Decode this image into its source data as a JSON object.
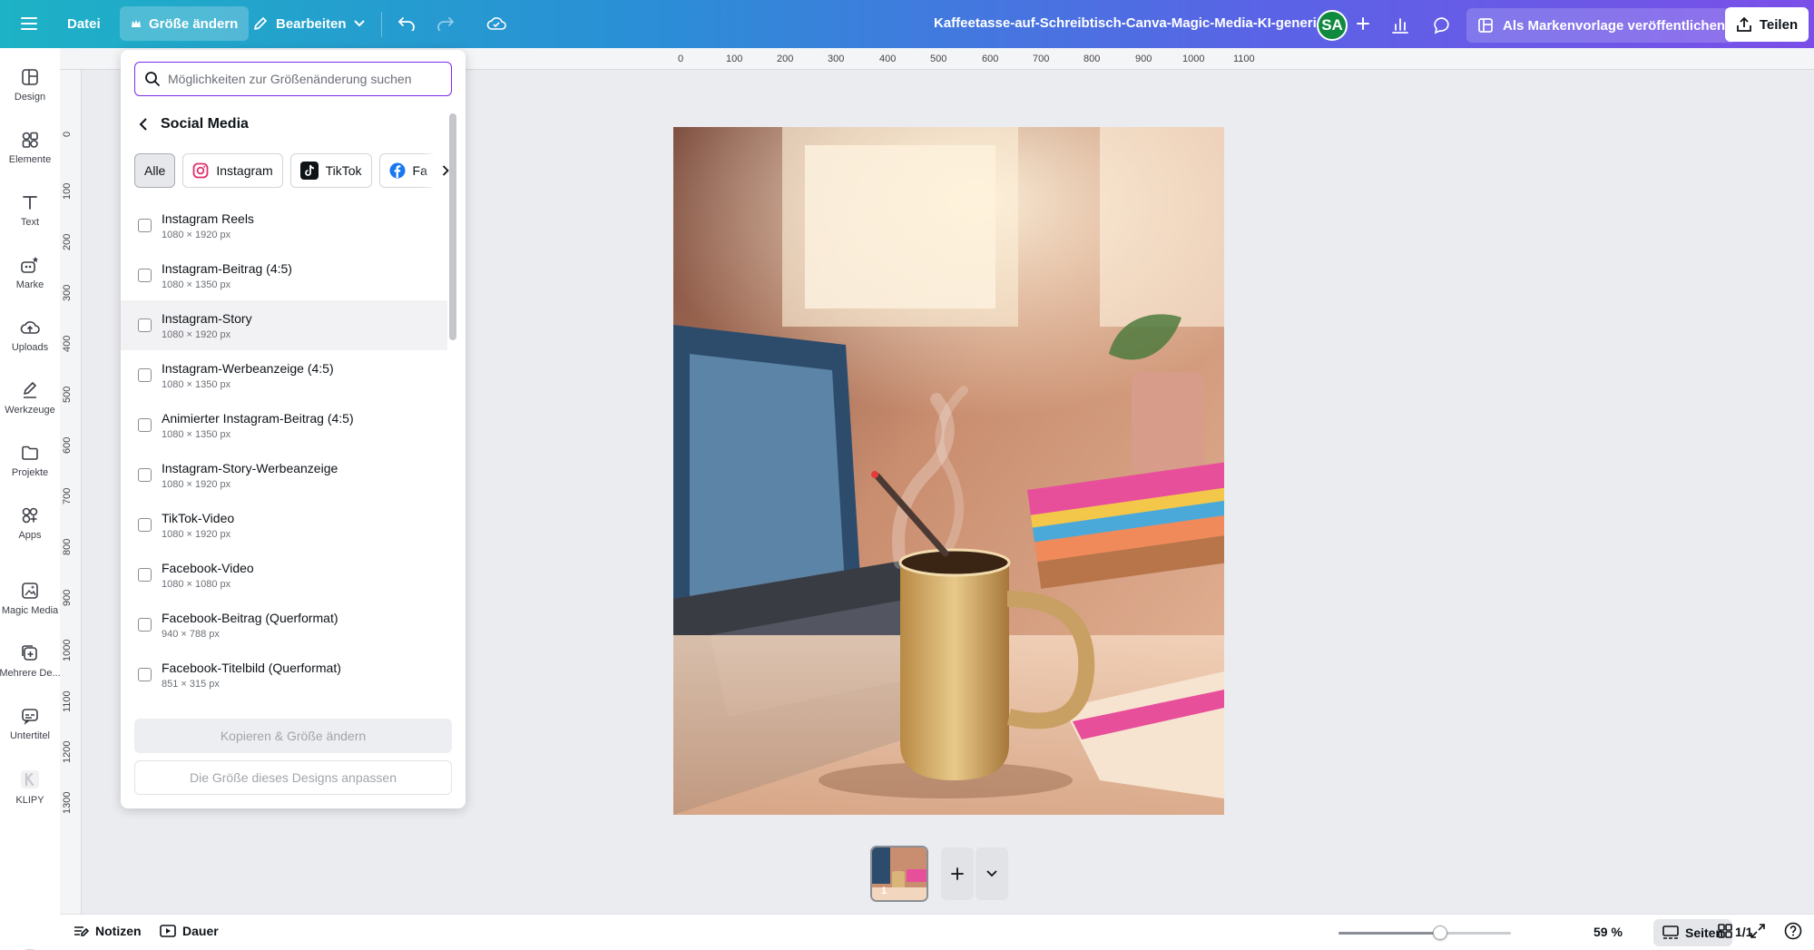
{
  "topbar": {
    "menu_icon": "hamburger-icon",
    "file_label": "Datei",
    "resize_label": "Größe ändern",
    "edit_label": "Bearbeiten",
    "doc_title": "Kaffeetasse-auf-Schreibtisch-Canva-Magic-Media-KI-generi...",
    "avatar_initials": "SA",
    "brand_template_label": "Als Markenvorlage veröffentlichen",
    "share_label": "Teilen"
  },
  "rail": {
    "items": [
      {
        "label": "Design",
        "icon": "layout-icon"
      },
      {
        "label": "Elemente",
        "icon": "shapes-icon"
      },
      {
        "label": "Text",
        "icon": "text-icon"
      },
      {
        "label": "Marke",
        "icon": "brand-icon"
      },
      {
        "label": "Uploads",
        "icon": "cloud-upload-icon"
      },
      {
        "label": "Werkzeuge",
        "icon": "pen-icon"
      },
      {
        "label": "Projekte",
        "icon": "folder-icon"
      },
      {
        "label": "Apps",
        "icon": "apps-icon"
      },
      {
        "label": "Magic Media",
        "icon": "magic-media-icon"
      },
      {
        "label": "Mehrere De...",
        "icon": "multiple-designs-icon"
      },
      {
        "label": "Untertitel",
        "icon": "subtitles-icon"
      },
      {
        "label": "KLIPY",
        "icon": "klipy-icon"
      }
    ]
  },
  "ruler": {
    "top_ticks": [
      "0",
      "100",
      "200",
      "300",
      "400",
      "500",
      "600",
      "700",
      "800",
      "900",
      "1000",
      "1100"
    ],
    "left_ticks": [
      "0",
      "100",
      "200",
      "300",
      "400",
      "500",
      "600",
      "700",
      "800",
      "900",
      "1000",
      "1100",
      "1200",
      "1300"
    ]
  },
  "resize_panel": {
    "search_placeholder": "Möglichkeiten zur Größenänderung suchen",
    "section_title": "Social Media",
    "chips": [
      {
        "label": "Alle",
        "selected": true
      },
      {
        "label": "Instagram",
        "icon": "instagram-icon"
      },
      {
        "label": "TikTok",
        "icon": "tiktok-icon"
      },
      {
        "label": "Fa",
        "icon": "facebook-icon"
      }
    ],
    "items": [
      {
        "name": "Instagram Reels",
        "size": "1080 × 1920 px",
        "checked": false
      },
      {
        "name": "Instagram-Beitrag (4:5)",
        "size": "1080 × 1350 px",
        "checked": false
      },
      {
        "name": "Instagram-Story",
        "size": "1080 × 1920 px",
        "checked": false,
        "hovered": true
      },
      {
        "name": "Instagram-Werbeanzeige (4:5)",
        "size": "1080 × 1350 px",
        "checked": false
      },
      {
        "name": "Animierter Instagram-Beitrag (4:5)",
        "size": "1080 × 1350 px",
        "checked": false
      },
      {
        "name": "Instagram-Story-Werbeanzeige",
        "size": "1080 × 1920 px",
        "checked": false
      },
      {
        "name": "TikTok-Video",
        "size": "1080 × 1920 px",
        "checked": false
      },
      {
        "name": "Facebook-Video",
        "size": "1080 × 1080 px",
        "checked": false
      },
      {
        "name": "Facebook-Beitrag (Querformat)",
        "size": "940 × 788 px",
        "checked": false
      },
      {
        "name": "Facebook-Titelbild (Querformat)",
        "size": "851 × 315 px",
        "checked": false
      }
    ],
    "copy_resize_label": "Kopieren & Größe ändern",
    "adapt_label": "Die Größe dieses Designs anpassen"
  },
  "pages": {
    "thumb_number": "1"
  },
  "bottombar": {
    "notes_label": "Notizen",
    "duration_label": "Dauer",
    "zoom_percent": 59,
    "zoom_label": "59 %",
    "pages_label": "Seiten",
    "page_count": "1/1"
  },
  "colors": {
    "accent": "#7d2ae8",
    "topbar_start": "#1db2c5",
    "topbar_end": "#7a4fe8",
    "avatar": "#0f8a3e"
  }
}
